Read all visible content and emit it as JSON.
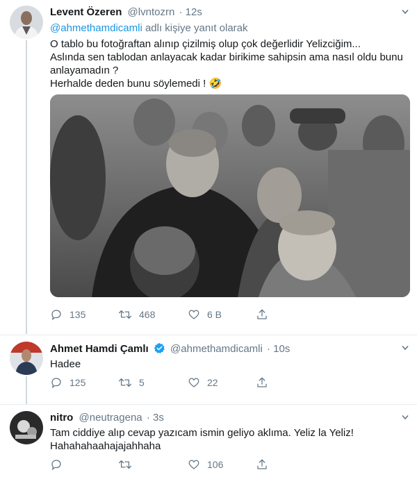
{
  "tweets": [
    {
      "name": "Levent Özeren",
      "handle": "@lvntozrn",
      "time": "· 12s",
      "reply_context_mention": "@ahmethamdicamli",
      "reply_context_suffix": " adlı kişiye yanıt olarak",
      "lines": [
        "O tablo bu fotoğraftan alınıp çizilmiş olup çok değerlidir Yelizciğim...",
        "Aslında sen tablodan anlayacak kadar birikime sahipsin ama nasıl oldu bunu",
        "anlayamadın ?",
        "Herhalde deden bunu söylemedi ! 🤣"
      ],
      "replies": "135",
      "retweets": "468",
      "likes": "6 B"
    },
    {
      "name": "Ahmet Hamdi Çamlı",
      "handle": "@ahmethamdicamli",
      "time": "· 10s",
      "verified": true,
      "lines": [
        "Hadee"
      ],
      "replies": "125",
      "retweets": "5",
      "likes": "22"
    },
    {
      "name": "nitro",
      "handle": "@neutragena",
      "time": "· 3s",
      "lines": [
        "Tam ciddiye alıp cevap yazıcam ismin geliyo aklıma. Yeliz la Yeliz!",
        "Hahahahaahajajahhaha"
      ],
      "replies": "",
      "retweets": "",
      "likes": "106"
    }
  ],
  "icons": {
    "reply": "reply-icon",
    "retweet": "retweet-icon",
    "like": "heart-icon",
    "share": "share-icon",
    "verified": "verified-badge-icon",
    "more": "chevron-down-icon"
  },
  "colors": {
    "text": "#14171a",
    "secondary": "#657786",
    "link": "#1b95e0",
    "verified": "#1da1f2"
  }
}
